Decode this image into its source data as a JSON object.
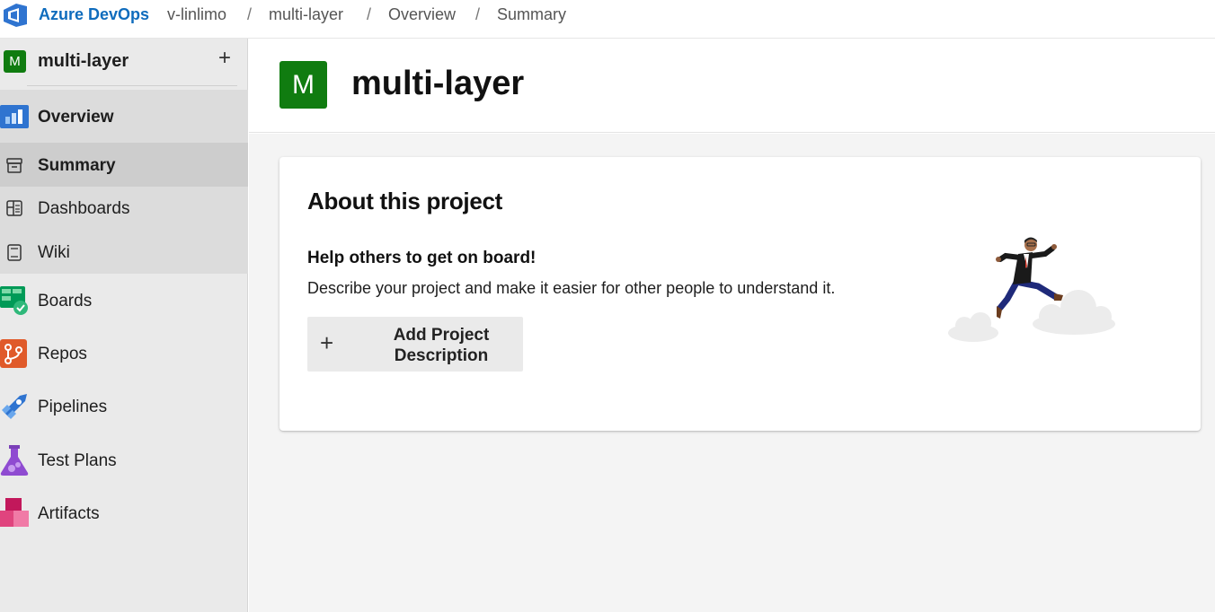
{
  "topbar": {
    "brand": "Azure DevOps",
    "breadcrumbs": [
      "v-linlimo",
      "multi-layer",
      "Overview",
      "Summary"
    ],
    "separator": "/"
  },
  "sidebar": {
    "project_badge": "M",
    "project_name": "multi-layer",
    "add_symbol": "+",
    "items": [
      {
        "label": "Overview",
        "icon": "overview-icon"
      },
      {
        "label": "Summary",
        "icon": "summary-icon",
        "selected": true
      },
      {
        "label": "Dashboards",
        "icon": "dashboards-icon"
      },
      {
        "label": "Wiki",
        "icon": "wiki-icon"
      },
      {
        "label": "Boards",
        "icon": "boards-icon"
      },
      {
        "label": "Repos",
        "icon": "repos-icon"
      },
      {
        "label": "Pipelines",
        "icon": "pipelines-icon"
      },
      {
        "label": "Test Plans",
        "icon": "test-plans-icon"
      },
      {
        "label": "Artifacts",
        "icon": "artifacts-icon"
      }
    ]
  },
  "header": {
    "badge": "M",
    "title": "multi-layer"
  },
  "about": {
    "title": "About this project",
    "subtitle": "Help others to get on board!",
    "description": "Describe your project and make it easier for other people to understand it.",
    "button_plus": "+",
    "button_label_line1": "Add Project",
    "button_label_line2": "Description"
  },
  "colors": {
    "brand_blue": "#0f6cbd",
    "project_green": "#107c10",
    "sidebar_bg": "#eaeaea",
    "selected_bg": "#cdcdcd"
  }
}
